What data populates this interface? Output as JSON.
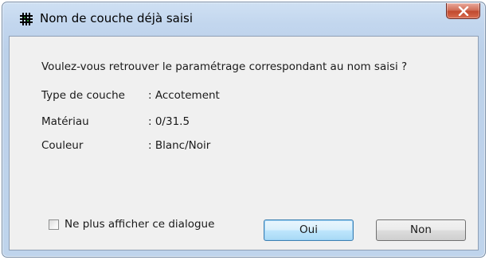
{
  "window": {
    "title": "Nom de couche déjà saisi",
    "icon": "grid-app-icon",
    "close_label": "X"
  },
  "question": "Voulez-vous retrouver le paramétrage correspondant au nom saisi ?",
  "fields": [
    {
      "label": "Type de couche",
      "value": ": Accotement"
    },
    {
      "label": "Matériau",
      "value": ": 0/31.5"
    },
    {
      "label": "Couleur",
      "value": ": Blanc/Noir"
    }
  ],
  "checkbox": {
    "label": "Ne plus afficher ce dialogue",
    "checked": false
  },
  "buttons": {
    "yes_label": "Oui",
    "no_label": "Non"
  },
  "colors": {
    "title_bar": "#c2d6ee",
    "close_button": "#c14a2f",
    "client_bg": "#f0f0f0",
    "default_button_border": "#3c7fb1"
  }
}
